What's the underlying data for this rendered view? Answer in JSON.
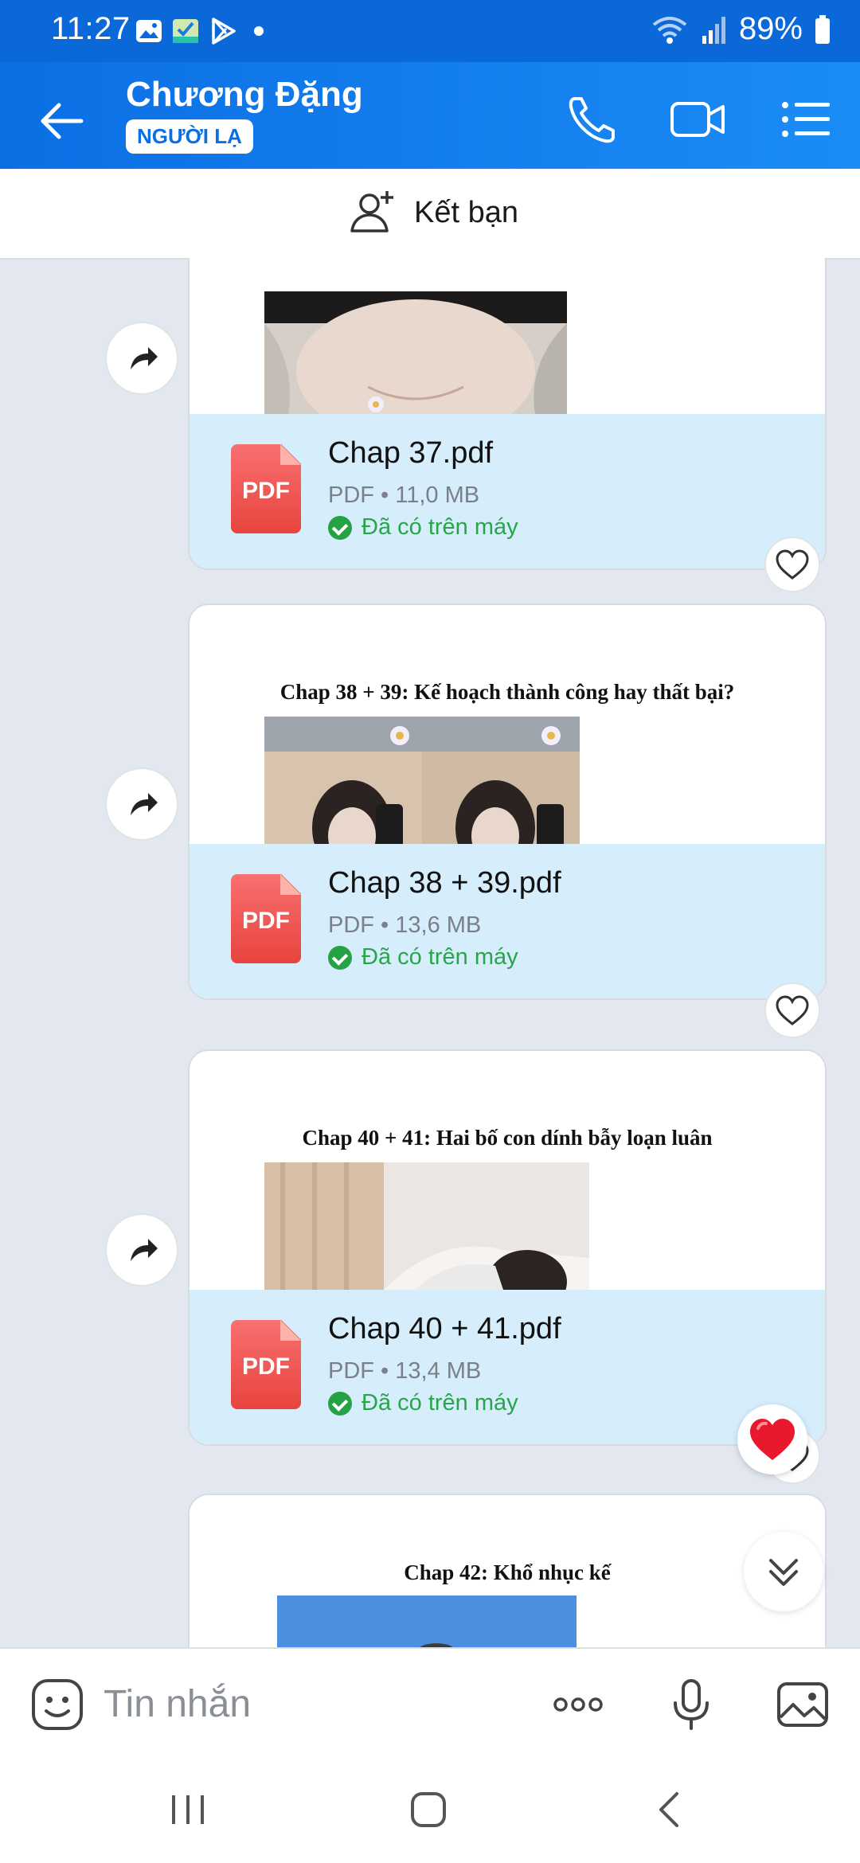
{
  "status_bar": {
    "time": "11:27",
    "battery": "89%"
  },
  "header": {
    "contact_name": "Chương Đặng",
    "badge": "NGƯỜI LẠ"
  },
  "add_friend": {
    "label": "Kết bạn"
  },
  "messages": [
    {
      "preview_title": "",
      "file_name": "Chap 37.pdf",
      "file_meta": "PDF • 11,0 MB",
      "status": "Đã có trên máy"
    },
    {
      "preview_title": "Chap 38 + 39: Kế hoạch thành công hay thất bại?",
      "file_name": "Chap 38 + 39.pdf",
      "file_meta": "PDF • 13,6 MB",
      "status": "Đã có trên máy"
    },
    {
      "preview_title": "Chap 40 + 41: Hai bố con dính bẫy loạn luân",
      "file_name": "Chap 40 + 41.pdf",
      "file_meta": "PDF • 13,4 MB",
      "status": "Đã có trên máy"
    },
    {
      "preview_title": "Chap 42: Khổ nhục kế"
    }
  ],
  "pdf_icon_label": "PDF",
  "input": {
    "placeholder": "Tin nhắn"
  },
  "colors": {
    "header": "#0b6fe4",
    "file_bg": "#d6eefc",
    "status_green": "#2aa44a",
    "chat_bg": "#e3e8f0"
  }
}
